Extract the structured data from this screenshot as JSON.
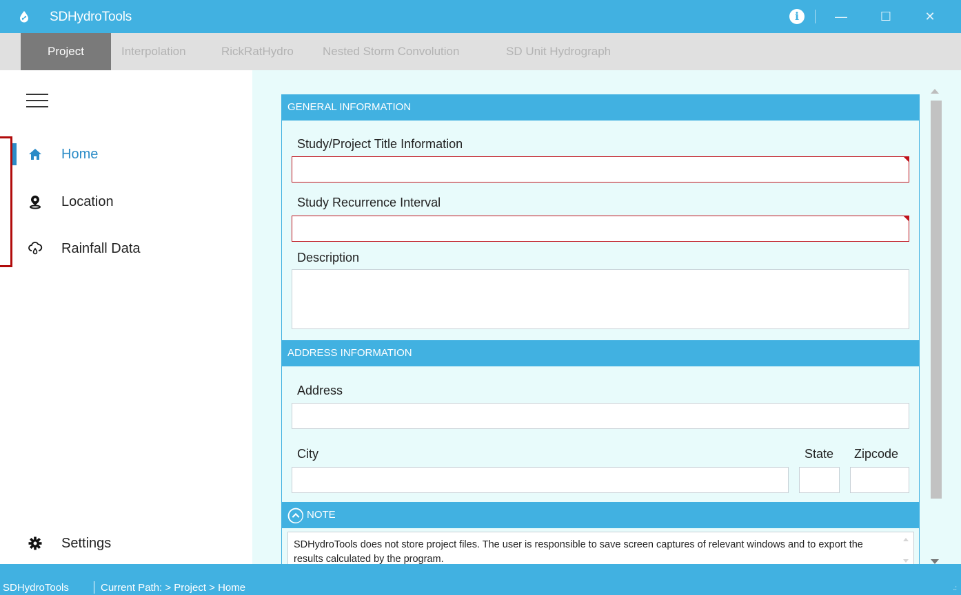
{
  "window": {
    "title": "SDHydroTools",
    "controls": {
      "minimize": "—",
      "maximize": "☐",
      "close": "✕"
    }
  },
  "tabs": [
    {
      "label": "Project",
      "active": true
    },
    {
      "label": "Interpolation",
      "active": false
    },
    {
      "label": "RickRatHydro",
      "active": false
    },
    {
      "label": "Nested Storm Convolution",
      "active": false
    },
    {
      "label": "SD Unit Hydrograph",
      "active": false
    }
  ],
  "sidebar": {
    "items": [
      {
        "label": "Home",
        "icon": "home-icon",
        "active": true
      },
      {
        "label": "Location",
        "icon": "location-pin-icon",
        "active": false
      },
      {
        "label": "Rainfall Data",
        "icon": "cloud-rain-icon",
        "active": false
      }
    ],
    "settings_label": "Settings"
  },
  "general": {
    "header": "GENERAL INFORMATION",
    "title_label": "Study/Project Title Information",
    "title_value": "",
    "recurrence_label": "Study Recurrence Interval",
    "recurrence_value": "",
    "description_label": "Description",
    "description_value": ""
  },
  "address": {
    "header": "ADDRESS INFORMATION",
    "address_label": "Address",
    "address_value": "",
    "city_label": "City",
    "city_value": "",
    "state_label": "State",
    "state_value": "",
    "zip_label": "Zipcode",
    "zip_value": ""
  },
  "note": {
    "header": "NOTE",
    "text": "SDHydroTools does not store project files. The user is responsible to save screen captures of relevant windows and to export the results calculated by the program."
  },
  "status": {
    "app": "SDHydroTools",
    "path": "Current Path:  > Project > Home"
  },
  "colors": {
    "accent": "#41b1e1",
    "active_nav": "#2a8bc7",
    "error": "#c0111b",
    "content_bg": "#e8fbfb"
  }
}
